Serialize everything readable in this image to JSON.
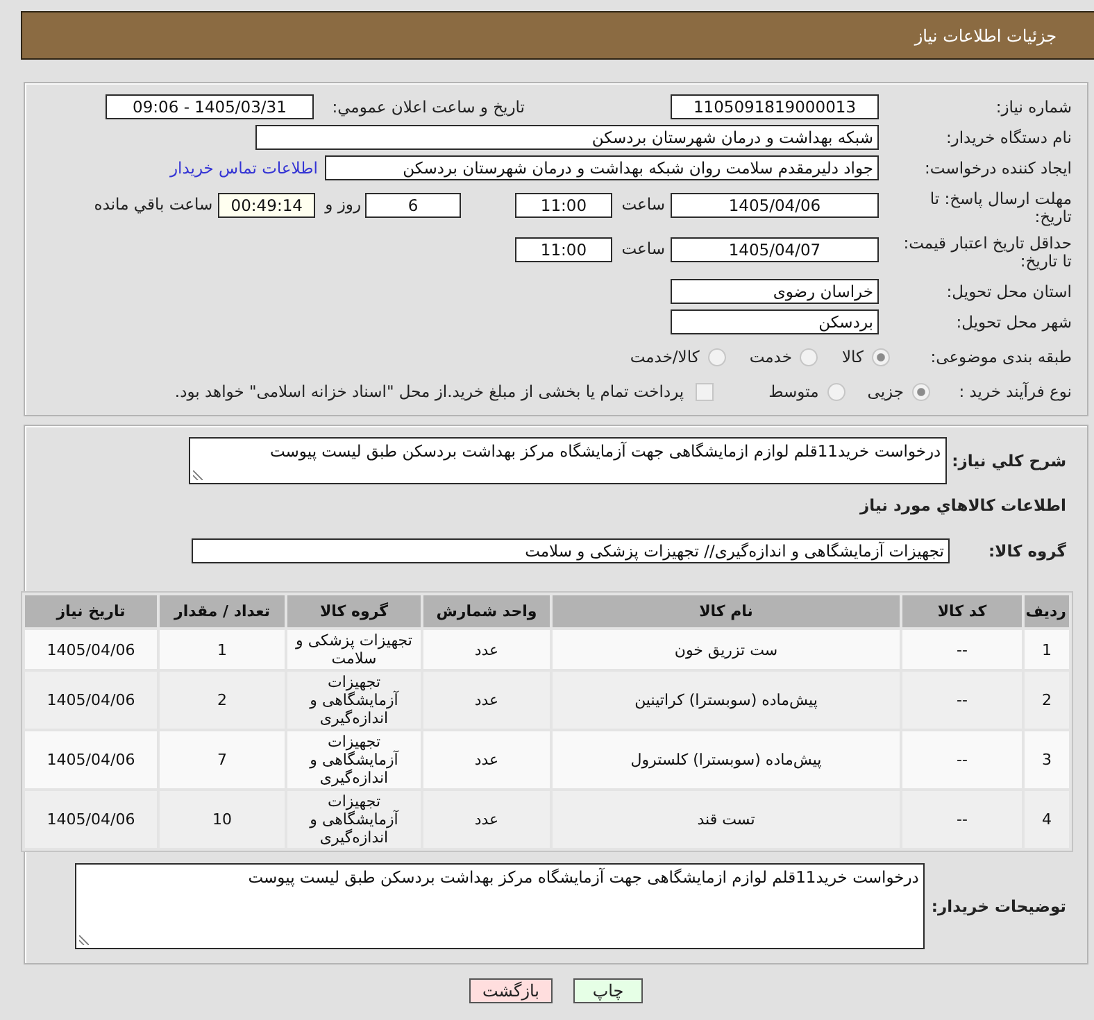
{
  "header": {
    "title": "جزئیات اطلاعات نیاز"
  },
  "need_number": {
    "label": "شماره نیاز:",
    "value": "1105091819000013"
  },
  "announcement": {
    "label": "تاریخ و ساعت اعلان عمومي:",
    "value": "1405/03/31 - 09:06"
  },
  "buyer_org": {
    "label": "نام دستگاه خریدار:",
    "value": "شبکه بهداشت و درمان شهرستان بردسکن"
  },
  "requester": {
    "label": "ایجاد کننده درخواست:",
    "value": "جواد دلیرمقدم سلامت روان شبکه بهداشت و درمان شهرستان بردسکن",
    "contact_link": "اطلاعات تماس خریدار"
  },
  "reply_deadline": {
    "label": "مهلت ارسال پاسخ: تا تاریخ:",
    "date": "1405/04/06",
    "time_label": "ساعت",
    "time": "11:00",
    "days": "6",
    "days_label": "روز و",
    "remaining": "00:49:14",
    "remaining_label": "ساعت باقي مانده"
  },
  "price_validity": {
    "label": "حداقل تاریخ اعتبار قیمت: تا تاریخ:",
    "date": "1405/04/07",
    "time_label": "ساعت",
    "time": "11:00"
  },
  "delivery_province": {
    "label": "استان محل تحویل:",
    "value": "خراسان رضوی"
  },
  "delivery_city": {
    "label": "شهر محل تحویل:",
    "value": "بردسکن"
  },
  "subject_category": {
    "label": "طبقه بندی موضوعی:",
    "options": [
      {
        "label": "کالا",
        "selected": true
      },
      {
        "label": "خدمت",
        "selected": false
      },
      {
        "label": "کالا/خدمت",
        "selected": false
      }
    ]
  },
  "purchase_process": {
    "label": "نوع فرآیند خرید :",
    "options": [
      {
        "label": "جزیی",
        "selected": true
      },
      {
        "label": "متوسط",
        "selected": false
      }
    ],
    "treasury_payment": {
      "label": "پرداخت تمام یا بخشی از مبلغ خرید.از محل \"اسناد خزانه اسلامی\" خواهد بود.",
      "checked": false
    }
  },
  "general_description": {
    "label": "شرح کلي نیاز:",
    "value": "درخواست خرید11قلم لوازم ازمایشگاهی جهت آزمایشگاه مرکز بهداشت بردسکن طبق لیست پیوست"
  },
  "goods_section": {
    "title": "اطلاعات کالاهاي مورد نیاز",
    "group": {
      "label": "گروه کالا:",
      "value": "تجهیزات آزمایشگاهی و اندازه‌گیری// تجهیزات پزشکی و سلامت"
    },
    "table": {
      "columns": [
        "ردیف",
        "کد کالا",
        "نام کالا",
        "واحد شمارش",
        "گروه کالا",
        "تعداد / مقدار",
        "تاریخ نیاز"
      ],
      "rows": [
        [
          "1",
          "--",
          "ست تزریق خون",
          "عدد",
          "تجهیزات پزشکی و سلامت",
          "1",
          "1405/04/06"
        ],
        [
          "2",
          "--",
          "پیش‌ماده (سوبسترا) کراتینین",
          "عدد",
          "تجهیزات آزمایشگاهی و اندازه‌گیری",
          "2",
          "1405/04/06"
        ],
        [
          "3",
          "--",
          "پیش‌ماده (سوبسترا) کلسترول",
          "عدد",
          "تجهیزات آزمایشگاهی و اندازه‌گیری",
          "7",
          "1405/04/06"
        ],
        [
          "4",
          "--",
          "تست قند",
          "عدد",
          "تجهیزات آزمایشگاهی و اندازه‌گیری",
          "10",
          "1405/04/06"
        ]
      ]
    }
  },
  "buyer_notes": {
    "label": "توضیحات خریدار:",
    "value": "درخواست خرید11قلم لوازم ازمایشگاهی جهت آزمایشگاه مرکز بهداشت بردسکن طبق لیست پیوست"
  },
  "buttons": [
    {
      "label": "چاپ",
      "kind": "print"
    },
    {
      "label": "بازگشت",
      "kind": "back"
    }
  ]
}
